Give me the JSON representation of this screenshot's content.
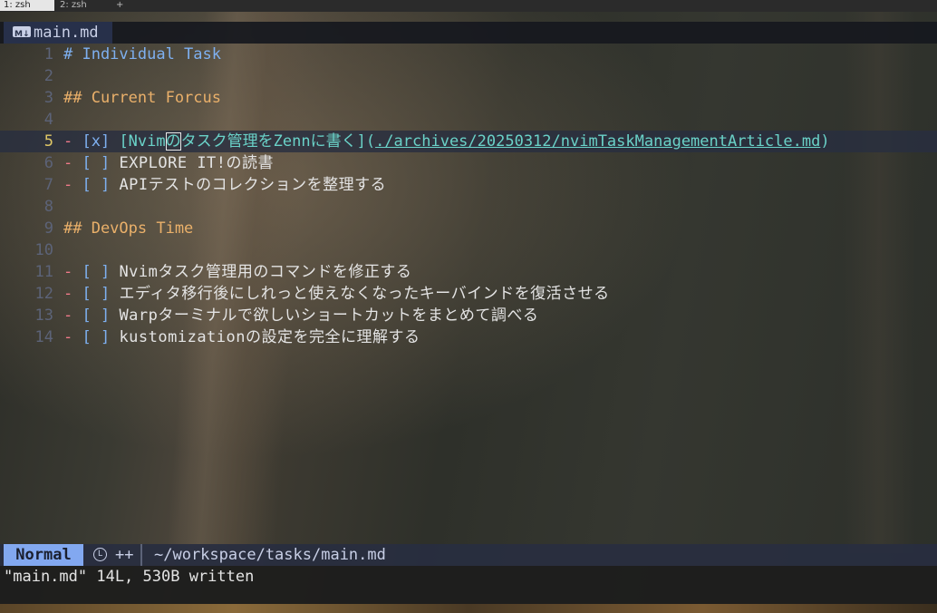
{
  "tmux": {
    "tabs": [
      {
        "label": "1: zsh"
      },
      {
        "label": "2: zsh"
      }
    ],
    "add_label": "+"
  },
  "buffer": {
    "name": "main.md",
    "icon": "markdown-icon"
  },
  "lines": [
    {
      "n": "1",
      "parts": [
        {
          "t": "# Individual Task",
          "c": "h1"
        }
      ]
    },
    {
      "n": "2",
      "parts": []
    },
    {
      "n": "3",
      "parts": [
        {
          "t": "## Current Forcus",
          "c": "h2"
        }
      ]
    },
    {
      "n": "4",
      "parts": []
    },
    {
      "n": "5",
      "current": true,
      "parts": [
        {
          "t": "- ",
          "c": "dash"
        },
        {
          "t": "[x] ",
          "c": "box"
        },
        {
          "t": "[Nvim",
          "c": "link-text"
        },
        {
          "t": "の",
          "c": "link-text cursor-char"
        },
        {
          "t": "タスク管理をZennに書く]",
          "c": "link-text"
        },
        {
          "t": "(",
          "c": "link-text"
        },
        {
          "t": "./archives/20250312/nvimTaskManagementArticle.md",
          "c": "link-url"
        },
        {
          "t": ")",
          "c": "link-text"
        }
      ]
    },
    {
      "n": "6",
      "parts": [
        {
          "t": "- ",
          "c": "dash"
        },
        {
          "t": "[ ] ",
          "c": "box"
        },
        {
          "t": "EXPLORE IT!の読書",
          "c": "text"
        }
      ]
    },
    {
      "n": "7",
      "parts": [
        {
          "t": "- ",
          "c": "dash"
        },
        {
          "t": "[ ] ",
          "c": "box"
        },
        {
          "t": "APIテストのコレクションを整理する",
          "c": "text"
        }
      ]
    },
    {
      "n": "8",
      "parts": []
    },
    {
      "n": "9",
      "parts": [
        {
          "t": "## DevOps Time",
          "c": "h2"
        }
      ]
    },
    {
      "n": "10",
      "parts": []
    },
    {
      "n": "11",
      "parts": [
        {
          "t": "- ",
          "c": "dash"
        },
        {
          "t": "[ ] ",
          "c": "box"
        },
        {
          "t": "Nvimタスク管理用のコマンドを修正する",
          "c": "text"
        }
      ]
    },
    {
      "n": "12",
      "parts": [
        {
          "t": "- ",
          "c": "dash"
        },
        {
          "t": "[ ] ",
          "c": "box"
        },
        {
          "t": "エディタ移行後にしれっと使えなくなったキーバインドを復活させる",
          "c": "text"
        }
      ]
    },
    {
      "n": "13",
      "parts": [
        {
          "t": "- ",
          "c": "dash"
        },
        {
          "t": "[ ] ",
          "c": "box"
        },
        {
          "t": "Warpターミナルで欲しいショートカットをまとめて調べる",
          "c": "text"
        }
      ]
    },
    {
      "n": "14",
      "parts": [
        {
          "t": "- ",
          "c": "dash"
        },
        {
          "t": "[ ] ",
          "c": "box"
        },
        {
          "t": "kustomizationの設定を完全に理解する",
          "c": "text"
        }
      ]
    }
  ],
  "statusline": {
    "mode": "Normal",
    "lsp_icon": "L",
    "plusplus": "++",
    "filepath": "~/workspace/tasks/main.md"
  },
  "cmdline": {
    "message": "\"main.md\" 14L, 530B written"
  }
}
